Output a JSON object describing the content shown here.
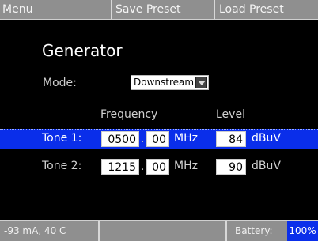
{
  "menubar": {
    "menu": "Menu",
    "save_preset": "Save Preset",
    "load_preset": "Load Preset"
  },
  "page": {
    "title": "Generator"
  },
  "mode": {
    "label": "Mode:",
    "value": "Downstream"
  },
  "columns": {
    "frequency": "Frequency",
    "level": "Level"
  },
  "tones": [
    {
      "label": "Tone 1:",
      "freq_int": "0500",
      "freq_dec": "00",
      "freq_unit": "MHz",
      "level": "84",
      "level_unit": "dBuV",
      "selected": true
    },
    {
      "label": "Tone 2:",
      "freq_int": "1215",
      "freq_dec": "00",
      "freq_unit": "MHz",
      "level": "90",
      "level_unit": "dBuV",
      "selected": false
    }
  ],
  "status": {
    "readout": "-93 mA, 40 C",
    "battery_label": "Battery:",
    "battery_pct": "100%"
  },
  "colors": {
    "menubar": "#8f8f8f",
    "selection": "#0a2eea",
    "background": "#000000"
  }
}
